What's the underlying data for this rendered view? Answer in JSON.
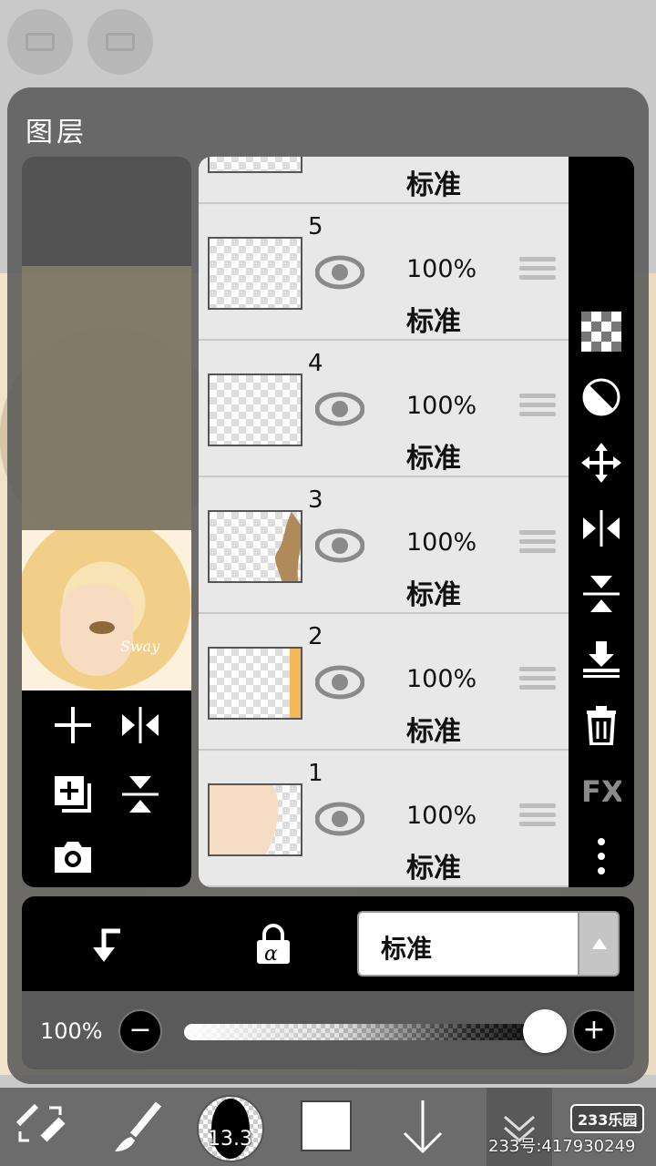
{
  "title": "图层",
  "layers": [
    {
      "num": "",
      "opacity": "",
      "blend": "标准",
      "thumb_fill": "transparent"
    },
    {
      "num": "5",
      "opacity": "100%",
      "blend": "标准",
      "thumb_fill": "transparent"
    },
    {
      "num": "4",
      "opacity": "100%",
      "blend": "标准",
      "thumb_fill": "transparent"
    },
    {
      "num": "3",
      "opacity": "100%",
      "blend": "标准",
      "thumb_fill": "brown-stroke"
    },
    {
      "num": "2",
      "opacity": "100%",
      "blend": "标准",
      "thumb_fill": "orange-edge"
    },
    {
      "num": "1",
      "opacity": "100%",
      "blend": "标准",
      "thumb_fill": "skin"
    }
  ],
  "blend_mode": {
    "selected": "标准"
  },
  "opacity": {
    "label": "100%",
    "value": 1.0
  },
  "preview": {
    "signature": "Sway"
  },
  "brush": {
    "size": "13.3"
  },
  "watermark": {
    "text": "233号:417930249",
    "logo": "233乐园"
  },
  "colors": {
    "panel_dark": "#000000",
    "row_bg": "#e8e8e8",
    "accent_yellow": "#f2cf88"
  }
}
